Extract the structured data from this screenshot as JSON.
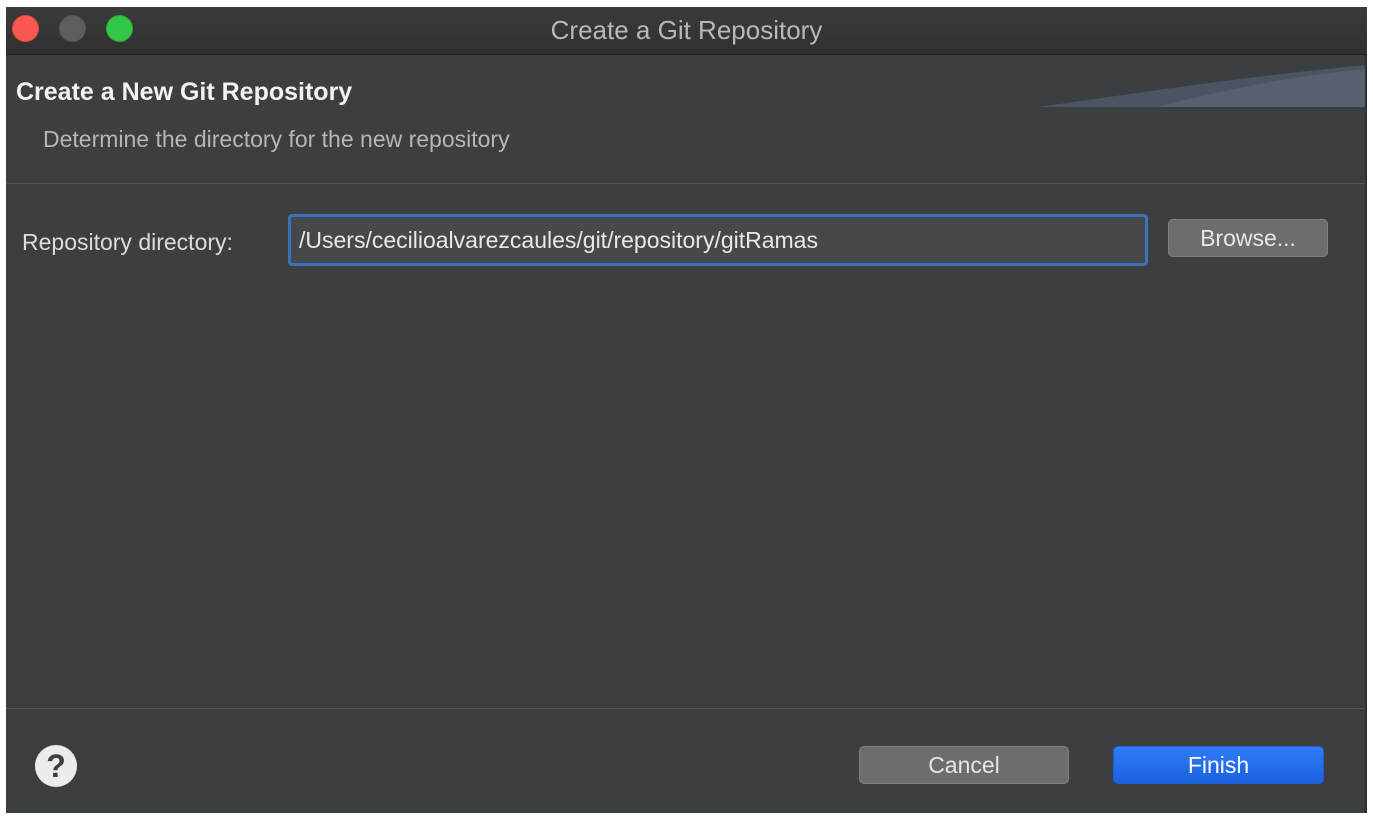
{
  "window": {
    "title": "Create a Git Repository"
  },
  "header": {
    "title": "Create a New Git Repository",
    "subtitle": "Determine the directory for the new repository"
  },
  "form": {
    "directory_label": "Repository directory:",
    "directory_value": "/Users/cecilioalvarezcaules/git/repository/gitRamas",
    "browse_label": "Browse..."
  },
  "footer": {
    "help_symbol": "?",
    "cancel_label": "Cancel",
    "finish_label": "Finish"
  },
  "colors": {
    "background": "#3c3f41",
    "accent": "#1a61e0",
    "focus_border": "#3a73b5",
    "close": "#fc5753",
    "zoom": "#33c748"
  }
}
